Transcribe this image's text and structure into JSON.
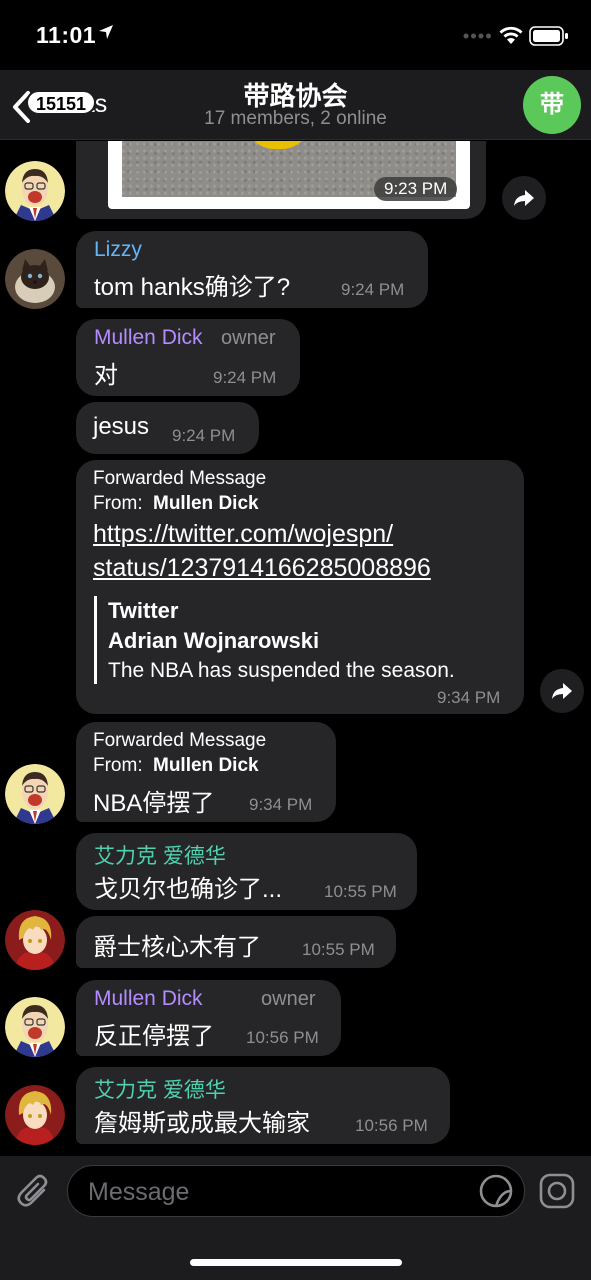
{
  "status_bar": {
    "time": "11:01"
  },
  "header": {
    "back_label": "Chats",
    "unread_count": "15151",
    "title": "带路协会",
    "subtitle": "17 members, 2 online",
    "avatar_initial": "带",
    "avatar_color": "#5bc95a"
  },
  "colors": {
    "lizzy": "#64b5f6",
    "mullen": "#b48cff",
    "edward": "#4fd1b0",
    "bubble": "#262628"
  },
  "messages": {
    "m0": {
      "time": "9:23 PM"
    },
    "m1": {
      "sender": "Lizzy",
      "text": "tom hanks确诊了?",
      "time": "9:24 PM"
    },
    "m2": {
      "sender": "Mullen Dick",
      "role": "owner",
      "text": "对",
      "time": "9:24 PM"
    },
    "m3": {
      "text": "jesus",
      "time": "9:24 PM"
    },
    "m4": {
      "forwarded": "Forwarded Message",
      "from_label": "From:",
      "from_name": "Mullen Dick",
      "link_line1": "https://twitter.com/wojespn/",
      "link_line2": "status/1237914166285008896",
      "preview_site": "Twitter",
      "preview_author": "Adrian Wojnarowski",
      "preview_text": "The NBA has suspended the season.",
      "time": "9:34 PM"
    },
    "m5": {
      "forwarded": "Forwarded Message",
      "from_label": "From:",
      "from_name": "Mullen Dick",
      "text": "NBA停摆了",
      "time": "9:34 PM"
    },
    "m6": {
      "sender": "艾力克 爱德华",
      "text": "戈贝尔也确诊了...",
      "time": "10:55 PM"
    },
    "m7": {
      "text": "爵士核心木有了",
      "time": "10:55 PM"
    },
    "m8": {
      "sender": "Mullen Dick",
      "role": "owner",
      "text": "反正停摆了",
      "time": "10:56 PM"
    },
    "m9": {
      "sender": "艾力克 爱德华",
      "text": "詹姆斯或成最大输家",
      "time": "10:56 PM"
    }
  },
  "input": {
    "placeholder": "Message"
  }
}
